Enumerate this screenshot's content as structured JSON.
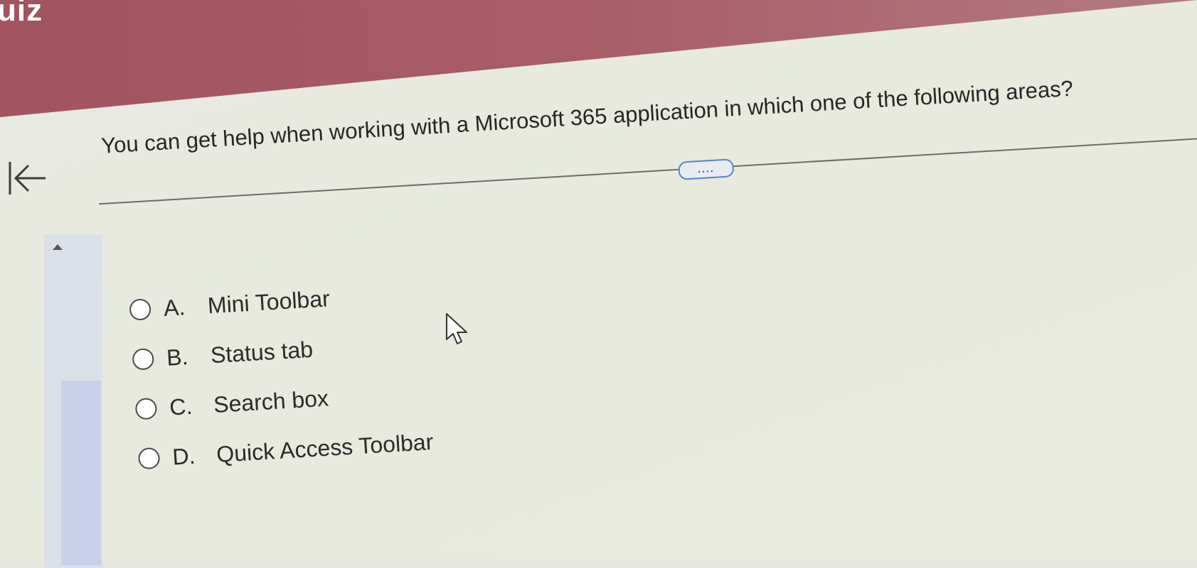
{
  "header": {
    "title": "uiz"
  },
  "navigation": {
    "back_icon": "back-to-start-icon"
  },
  "question": {
    "text": "You can get help when working with a Microsoft 365 application in which one of the following areas?",
    "more_button_label": "...."
  },
  "options": [
    {
      "letter": "A.",
      "label": "Mini Toolbar"
    },
    {
      "letter": "B.",
      "label": "Status tab"
    },
    {
      "letter": "C.",
      "label": "Search box"
    },
    {
      "letter": "D.",
      "label": "Quick Access Toolbar"
    }
  ],
  "colors": {
    "header": "#a2545f",
    "panel": "#e7eadd",
    "accent": "#5a83c4",
    "scroll_thumb": "#c7d0e6"
  }
}
